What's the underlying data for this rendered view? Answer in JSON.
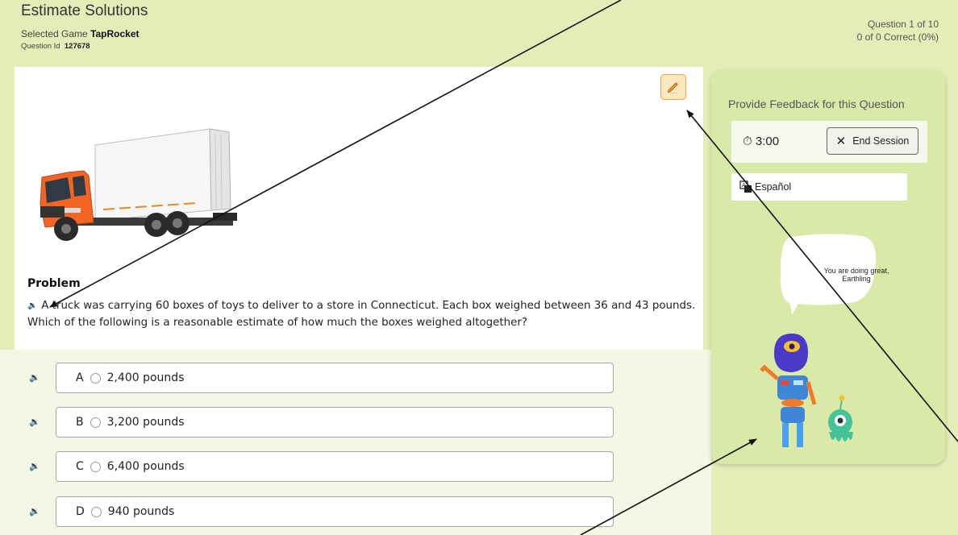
{
  "header": {
    "app_title": "Estimate Solutions",
    "game_label": "Selected Game",
    "game_name": "TapRocket",
    "question_id_label": "Question Id",
    "question_id": "127678",
    "question_progress": "Question 1 of 10",
    "correct_progress": "0 of 0 Correct (0%)"
  },
  "problem": {
    "heading": "Problem",
    "text": "A truck was carrying 60 boxes of toys to deliver to a store in Connecticut. Each box weighed between 36 and 43 pounds. Which of the following is a reasonable estimate of how much the boxes weighed altogether?"
  },
  "answers": [
    {
      "letter": "A",
      "text": "2,400 pounds"
    },
    {
      "letter": "B",
      "text": "3,200 pounds"
    },
    {
      "letter": "C",
      "text": "6,400 pounds"
    },
    {
      "letter": "D",
      "text": "940 pounds"
    }
  ],
  "sidebar": {
    "feedback_title": "Provide Feedback for this Question",
    "timer": "3:00",
    "end_session": "End Session",
    "language": "Español",
    "bubble_message": "You are doing great, Earthling"
  },
  "colors": {
    "page_bg": "#e3edb8",
    "side_panel_bg": "#dbe9a8",
    "answers_bg": "#f3f7e4",
    "pencil_button_bg": "#fde7bc",
    "pencil_button_border": "#f2a14a",
    "truck_cab": "#f26522"
  },
  "icons": {
    "edit": "pencil-icon",
    "audio": "speaker-icon",
    "timer": "stopwatch-icon",
    "close": "close-icon",
    "translate": "translate-icon"
  }
}
